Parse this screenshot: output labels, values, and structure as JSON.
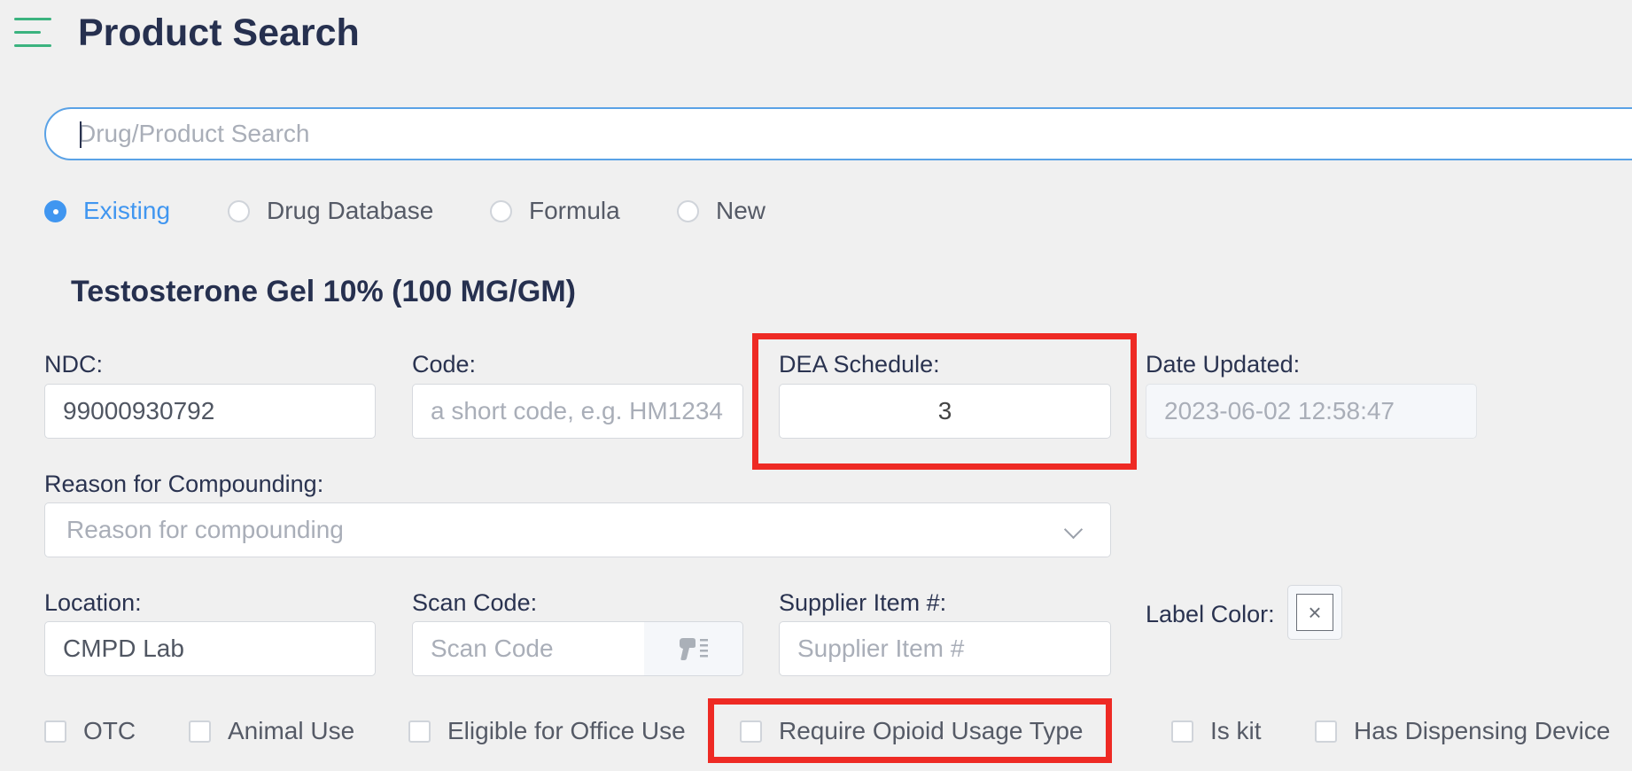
{
  "header": {
    "title": "Product Search",
    "menu_icon": "hamburger-menu-icon"
  },
  "search": {
    "placeholder": "Drug/Product Search",
    "value": ""
  },
  "source_options": [
    {
      "label": "Existing",
      "selected": true
    },
    {
      "label": "Drug Database",
      "selected": false
    },
    {
      "label": "Formula",
      "selected": false
    },
    {
      "label": "New",
      "selected": false
    }
  ],
  "product": {
    "name": "Testosterone Gel 10% (100 MG/GM)"
  },
  "fields": {
    "ndc": {
      "label": "NDC:",
      "value": "99000930792"
    },
    "code": {
      "label": "Code:",
      "placeholder": "a short code, e.g. HM1234"
    },
    "dea_schedule": {
      "label": "DEA Schedule:",
      "value": "3"
    },
    "date_updated": {
      "label": "Date Updated:",
      "value": "2023-06-02 12:58:47"
    },
    "reason": {
      "label": "Reason for Compounding:",
      "placeholder": "Reason for compounding"
    },
    "location": {
      "label": "Location:",
      "value": "CMPD Lab"
    },
    "scan_code": {
      "label": "Scan Code:",
      "placeholder": "Scan Code",
      "icon": "barcode-scanner-icon"
    },
    "supplier_item": {
      "label": "Supplier Item #:",
      "placeholder": "Supplier Item #"
    },
    "label_color": {
      "label": "Label Color:",
      "value_glyph": "×"
    }
  },
  "checkboxes": [
    {
      "label": "OTC",
      "checked": false
    },
    {
      "label": "Animal Use",
      "checked": false
    },
    {
      "label": "Eligible for Office Use",
      "checked": false
    },
    {
      "label": "Require Opioid Usage Type",
      "checked": false
    },
    {
      "label": "Is kit",
      "checked": false
    },
    {
      "label": "Has Dispensing Device",
      "checked": false
    }
  ],
  "colors": {
    "accent": "#4096f0",
    "menu_icon": "#3bb37f",
    "highlight": "#ee2a24",
    "title": "#26304f"
  }
}
